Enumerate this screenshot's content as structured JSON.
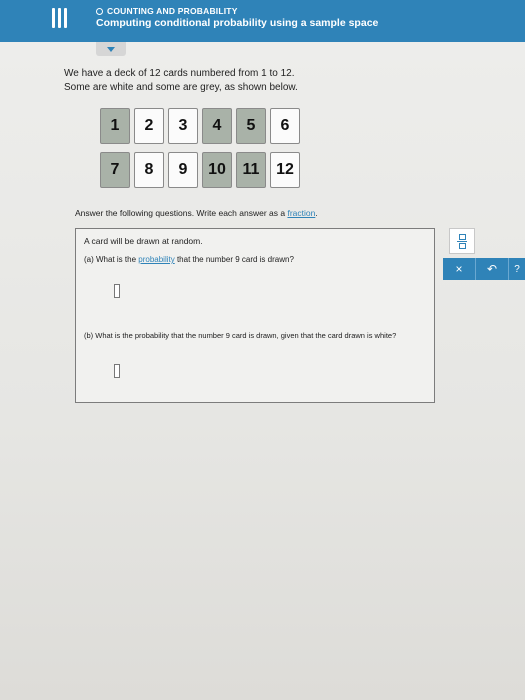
{
  "header": {
    "topic": "COUNTING AND PROBABILITY",
    "title": "Computing conditional probability using a sample space"
  },
  "intro": {
    "line1": "We have a deck of 12 cards numbered from 1 to 12.",
    "line2": "Some are white and some are grey, as shown below."
  },
  "cards": {
    "row1": [
      {
        "label": "1",
        "color": "grey"
      },
      {
        "label": "2",
        "color": "white"
      },
      {
        "label": "3",
        "color": "white"
      },
      {
        "label": "4",
        "color": "grey"
      },
      {
        "label": "5",
        "color": "grey"
      },
      {
        "label": "6",
        "color": "white"
      }
    ],
    "row2": [
      {
        "label": "7",
        "color": "grey"
      },
      {
        "label": "8",
        "color": "white"
      },
      {
        "label": "9",
        "color": "white"
      },
      {
        "label": "10",
        "color": "grey"
      },
      {
        "label": "11",
        "color": "grey"
      },
      {
        "label": "12",
        "color": "white"
      }
    ]
  },
  "instruction": {
    "prefix": "Answer the following questions. Write each answer as a ",
    "link": "fraction",
    "suffix": "."
  },
  "question": {
    "intro": "A card will be drawn at random.",
    "a_prefix": "(a)  What is the ",
    "a_link": "probability",
    "a_suffix": " that the number 9 card is drawn?",
    "a_value": "",
    "b_text": "(b)  What is the probability that the number 9 card is drawn, given that the card drawn is white?",
    "b_value": ""
  },
  "tools": {
    "clear_label": "×",
    "undo_label": "↶",
    "help_label": "?"
  },
  "colors": {
    "accent": "#2f83b8",
    "grey_card": "#a9b2a8",
    "white_card": "#fbfbfb"
  },
  "icons": {
    "menu": "hamburger-icon",
    "topic": "circle-icon",
    "collapse": "chevron-down-icon",
    "fraction": "fraction-icon",
    "clear": "close-icon",
    "undo": "undo-icon",
    "help": "help-icon"
  }
}
